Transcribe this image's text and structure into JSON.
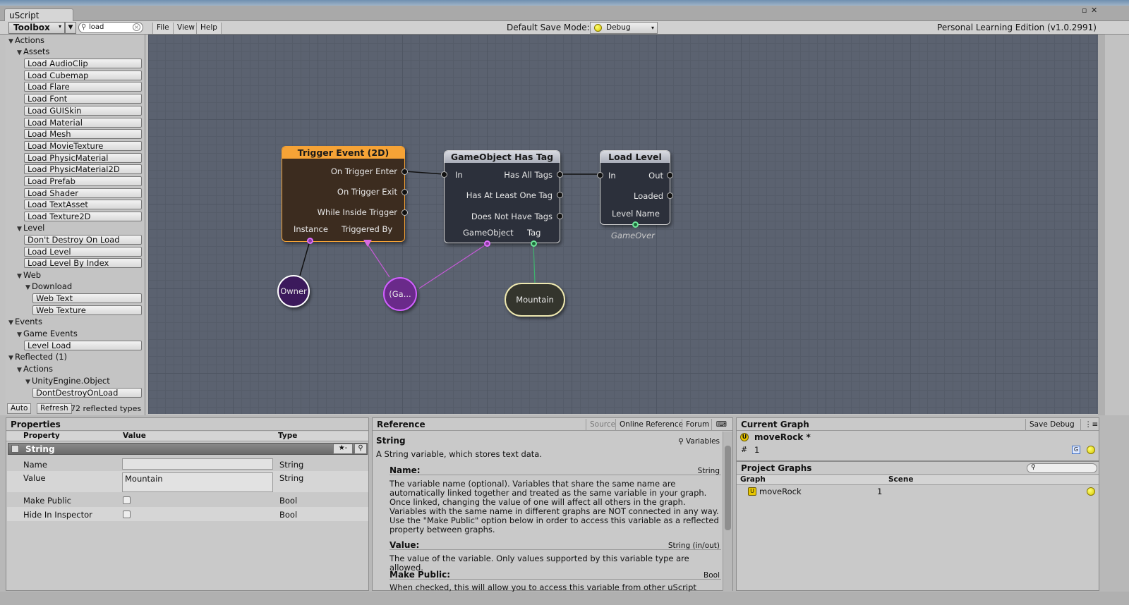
{
  "window": {
    "tab_title": "uScript",
    "controls": [
      "▫",
      "✕"
    ]
  },
  "toolbar": {
    "toolbox_label": "Toolbox",
    "search_value": "load",
    "menu": [
      "File",
      "View",
      "Help"
    ],
    "save_mode_label": "Default Save Mode:",
    "save_mode_value": "Debug",
    "edition": "Personal Learning Edition (v1.0.2991)"
  },
  "toolbox": {
    "actions": "Actions",
    "assets": "Assets",
    "asset_items": [
      "Load AudioClip",
      "Load Cubemap",
      "Load Flare",
      "Load Font",
      "Load GUISkin",
      "Load Material",
      "Load Mesh",
      "Load MovieTexture",
      "Load PhysicMaterial",
      "Load PhysicMaterial2D",
      "Load Prefab",
      "Load Shader",
      "Load TextAsset",
      "Load Texture2D"
    ],
    "level": "Level",
    "level_items": [
      "Don't Destroy On Load",
      "Load Level",
      "Load Level By Index"
    ],
    "web": "Web",
    "download": "Download",
    "download_items": [
      "Web Text",
      "Web Texture"
    ],
    "events": "Events",
    "game_events": "Game Events",
    "event_items": [
      "Level Load"
    ],
    "reflected": "Reflected (1)",
    "reflected_actions": "Actions",
    "unity_object": "UnityEngine.Object",
    "reflected_items": [
      "DontDestroyOnLoad"
    ],
    "footer": {
      "auto": "Auto",
      "refresh": "Refresh",
      "count": "72 reflected types"
    }
  },
  "graph": {
    "trigger": {
      "title": "Trigger Event (2D)",
      "outputs": [
        "On Trigger Enter",
        "On Trigger Exit",
        "While Inside Trigger"
      ],
      "vars": [
        "Instance",
        "Triggered By"
      ],
      "color": "#f6a336"
    },
    "has_tag": {
      "title": "GameObject Has Tag",
      "input": "In",
      "outputs": [
        "Has All Tags",
        "Has At Least One Tag",
        "Does Not Have Tags"
      ],
      "vars": [
        "GameObject",
        "Tag"
      ]
    },
    "load_level": {
      "title": "Load Level",
      "input": "In",
      "outputs": [
        "Out",
        "Loaded"
      ],
      "var": "Level Name",
      "var_value": "GameOver"
    },
    "owner": "Owner",
    "gameobject_var": "(Ga...",
    "mountain": "Mountain"
  },
  "properties": {
    "title": "Properties",
    "cols": [
      "Property",
      "Value",
      "Type"
    ],
    "section": "String",
    "rows": [
      {
        "name": "Name",
        "value": "",
        "type": "String"
      },
      {
        "name": "Value",
        "value": "Mountain",
        "type": "String"
      },
      {
        "name": "Make Public",
        "type": "Bool"
      },
      {
        "name": "Hide In Inspector",
        "type": "Bool"
      }
    ]
  },
  "reference": {
    "title": "Reference",
    "links": [
      "Source",
      "Online Reference",
      "Forum"
    ],
    "subject": "String",
    "category": "Variables",
    "intro": "A String variable, which stores text data.",
    "sections": [
      {
        "h": "Name:",
        "t": "String",
        "body": "The variable name (optional). Variables that share the same name are automatically linked together and treated as the same variable in your graph. Once linked, changing the value of one will affect all others in the graph. Variables with the same name in different graphs are NOT connected in any way. Use the \"Make Public\" option below in order to access this variable as a reflected property between graphs."
      },
      {
        "h": "Value:",
        "t": "String (in/out)",
        "body": "The value of the variable. Only values supported by this variable type are allowed."
      },
      {
        "h": "Make Public:",
        "t": "Bool",
        "body": "When checked, this will allow you to access this variable from other uScript graphs"
      }
    ]
  },
  "current_graph": {
    "title": "Current Graph",
    "save_debug": "Save Debug",
    "name": "moveRock *",
    "count": "1"
  },
  "project_graphs": {
    "title": "Project Graphs",
    "cols": [
      "Graph",
      "Scene"
    ],
    "rows": [
      {
        "graph": "moveRock",
        "scene": "1"
      }
    ]
  },
  "colors": {
    "canvas": "#5b6270",
    "trigger": "#f6a336",
    "node_body": "#2c303b",
    "owner": "#3c1a5c"
  }
}
